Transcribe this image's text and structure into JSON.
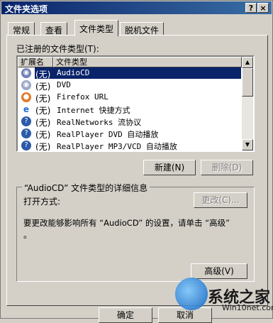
{
  "title": "文件夹选项",
  "title_buttons": {
    "help": "?",
    "close": "×"
  },
  "tabs": [
    "常规",
    "查看",
    "文件类型",
    "脱机文件"
  ],
  "registered_label": "已注册的文件类型(T):",
  "columns": [
    "扩展名",
    "文件类型"
  ],
  "rows": [
    {
      "ext": "(无)",
      "type": "AudioCD",
      "icon": "audiocd-icon",
      "selected": true
    },
    {
      "ext": "(无)",
      "type": "DVD",
      "icon": "dvd-icon",
      "selected": false
    },
    {
      "ext": "(无)",
      "type": "Firefox URL",
      "icon": "firefox-icon",
      "selected": false
    },
    {
      "ext": "(无)",
      "type": "Internet 快捷方式",
      "icon": "ie-icon",
      "selected": false
    },
    {
      "ext": "(无)",
      "type": "RealNetworks 流协议",
      "icon": "realplayer-icon",
      "selected": false
    },
    {
      "ext": "(无)",
      "type": "RealPlayer DVD 自动播放",
      "icon": "realplayer-icon",
      "selected": false
    },
    {
      "ext": "(无)",
      "type": "RealPlayer MP3/VCD 自动播放",
      "icon": "realplayer-icon",
      "selected": false
    }
  ],
  "buttons": {
    "new": "新建(N)",
    "delete": "删除(D)",
    "change": "更改(C)...",
    "advanced": "高级(V)",
    "ok": "确定",
    "cancel": "取消"
  },
  "details": {
    "group_title": "“AudioCD” 文件类型的详细信息",
    "open_with_label": "打开方式:",
    "desc_line1": "要更改能够影响所有 “AudioCD” 的设置，请单击 “高级”",
    "desc_line2": "。"
  },
  "watermark": {
    "name": "系统之家",
    "url": "Win10net.com"
  }
}
